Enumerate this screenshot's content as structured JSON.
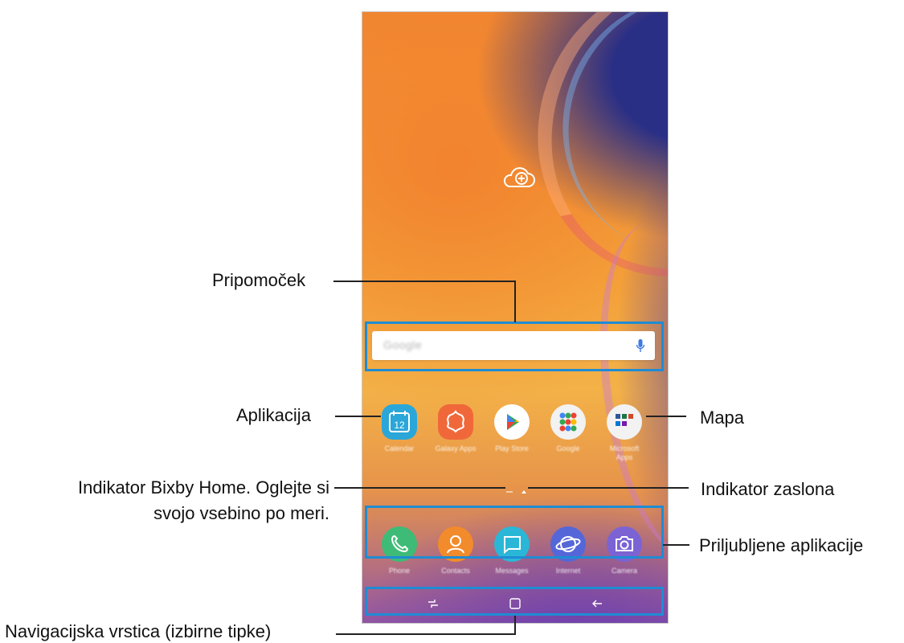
{
  "labels": {
    "widget": "Pripomoček",
    "app": "Aplikacija",
    "folder": "Mapa",
    "bixby_line1": "Indikator Bixby Home. Oglejte si",
    "bixby_line2": "svojo vsebino po meri.",
    "screen_indicator": "Indikator zaslona",
    "favorite_apps": "Priljubljene aplikacije",
    "navigation_bar": "Navigacijska vrstica (izbirne tipke)"
  },
  "home": {
    "search_logo": "Google",
    "apps": [
      {
        "label": "Calendar",
        "icon": "calendar-icon",
        "day": "12",
        "color": "#2aa7d8"
      },
      {
        "label": "Galaxy Apps",
        "icon": "galaxy-apps-icon",
        "color": "#f0683a"
      },
      {
        "label": "Play Store",
        "icon": "play-store-icon",
        "color": "#ffffff"
      },
      {
        "label": "Google",
        "icon": "google-folder-icon",
        "color": "#f2f2f2"
      },
      {
        "label": "Microsoft Apps",
        "icon": "microsoft-folder-icon",
        "color": "#f2f2f2"
      }
    ],
    "dock": [
      {
        "label": "Phone",
        "icon": "phone-icon",
        "color": "#3ebb76"
      },
      {
        "label": "Contacts",
        "icon": "contacts-icon",
        "color": "#f28b2c"
      },
      {
        "label": "Messages",
        "icon": "messages-icon",
        "color": "#2ab7d7"
      },
      {
        "label": "Internet",
        "icon": "internet-icon",
        "color": "#5567d8"
      },
      {
        "label": "Camera",
        "icon": "camera-icon",
        "color": "#7b63d4"
      }
    ],
    "nav_keys": [
      "recent-apps-icon",
      "home-key-icon",
      "back-icon"
    ]
  },
  "colors": {
    "highlight": "#1f8cd3"
  }
}
